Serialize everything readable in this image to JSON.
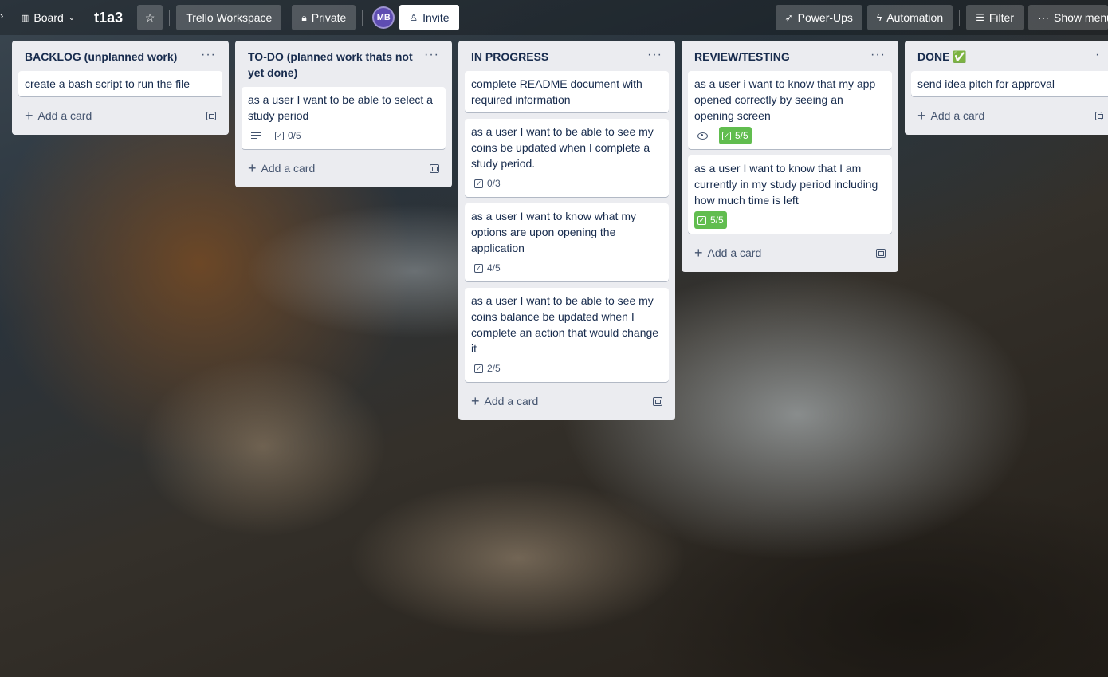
{
  "topbar": {
    "view_label": "Board",
    "board_title": "t1a3",
    "workspace_label": "Trello Workspace",
    "visibility_label": "Private",
    "avatar_initials": "MB",
    "invite_label": "Invite",
    "powerups_label": "Power-Ups",
    "automation_label": "Automation",
    "filter_label": "Filter",
    "show_menu_label": "Show menu"
  },
  "colors": {
    "list_bg": "#ebecf0",
    "complete_badge": "#61bd4f",
    "avatar_bg": "#5e4db2"
  },
  "add_card_label": "Add a card",
  "lists": [
    {
      "title": "BACKLOG (unplanned work)",
      "cards": [
        {
          "text": "create a bash script to run the file"
        }
      ]
    },
    {
      "title": "TO-DO (planned work thats not yet done)",
      "cards": [
        {
          "text": "as a user I want to be able to select a study period",
          "has_description": true,
          "checklist": "0/5"
        }
      ]
    },
    {
      "title": "IN PROGRESS",
      "cards": [
        {
          "text": "complete README document with required information"
        },
        {
          "text": "as a user I want to be able to see my coins be updated when I complete a study period.",
          "checklist": "0/3"
        },
        {
          "text": "as a user I want to know what my options are upon opening the application",
          "checklist": "4/5"
        },
        {
          "text": "as a user I want to be able to see my coins balance be updated when I complete an action that would change it",
          "checklist": "2/5"
        }
      ]
    },
    {
      "title": "REVIEW/TESTING",
      "cards": [
        {
          "text": "as a user i want to know that my app opened correctly by seeing an opening screen",
          "watching": true,
          "checklist": "5/5",
          "checklist_complete": true
        },
        {
          "text": "as a user I want to know that I am currently in my study period including how much time is left",
          "checklist": "5/5",
          "checklist_complete": true
        }
      ]
    },
    {
      "title": "DONE ✅",
      "cards": [
        {
          "text": "send idea pitch for approval"
        }
      ]
    }
  ]
}
